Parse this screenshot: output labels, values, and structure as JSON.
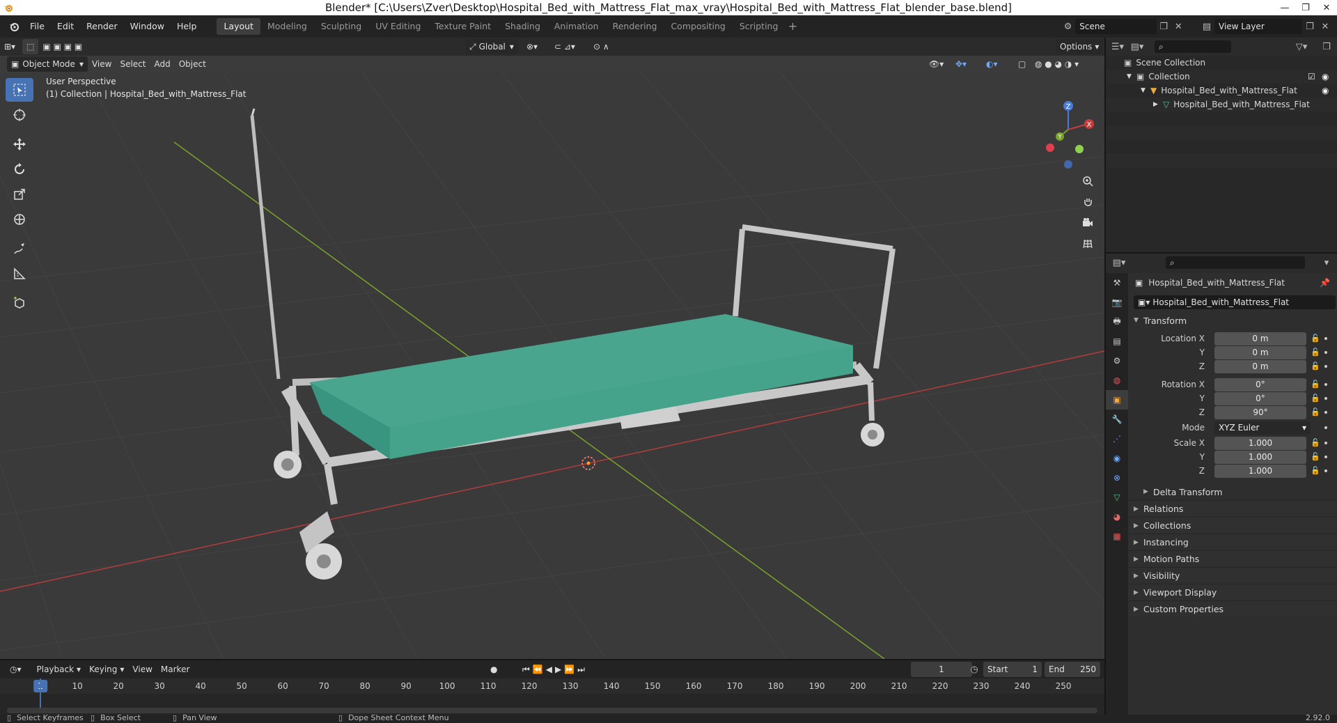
{
  "window": {
    "title": "Blender* [C:\\Users\\Zver\\Desktop\\Hospital_Bed_with_Mattress_Flat_max_vray\\Hospital_Bed_with_Mattress_Flat_blender_base.blend]"
  },
  "menu": {
    "items": [
      "File",
      "Edit",
      "Render",
      "Window",
      "Help"
    ]
  },
  "workspaces": [
    "Layout",
    "Modeling",
    "Sculpting",
    "UV Editing",
    "Texture Paint",
    "Shading",
    "Animation",
    "Rendering",
    "Compositing",
    "Scripting"
  ],
  "active_workspace": "Layout",
  "scene": {
    "name": "Scene"
  },
  "view_layer": {
    "name": "View Layer"
  },
  "viewport": {
    "mode": "Object Mode",
    "menus": [
      "View",
      "Select",
      "Add",
      "Object"
    ],
    "transform_orientation": "Global",
    "options_label": "Options",
    "perspective_label": "User Perspective",
    "collection_label": "(1) Collection | Hospital_Bed_with_Mattress_Flat",
    "gizmo_axes": {
      "x": "X",
      "y": "Y",
      "z": "Z"
    }
  },
  "outliner": {
    "rows": [
      {
        "label": "Scene Collection"
      },
      {
        "label": "Collection"
      },
      {
        "label": "Hospital_Bed_with_Mattress_Flat"
      },
      {
        "label": "Hospital_Bed_with_Mattress_Flat"
      }
    ]
  },
  "properties": {
    "object_name": "Hospital_Bed_with_Mattress_Flat",
    "name_field": "Hospital_Bed_with_Mattress_Flat",
    "transform_title": "Transform",
    "location": {
      "label": "Location X",
      "x": "0 m",
      "y": "0 m",
      "z": "0 m"
    },
    "rotation": {
      "label": "Rotation X",
      "x": "0°",
      "y": "0°",
      "z": "90°"
    },
    "mode": {
      "label": "Mode",
      "value": "XYZ Euler"
    },
    "scale": {
      "label": "Scale X",
      "x": "1.000",
      "y": "1.000",
      "z": "1.000"
    },
    "axis_y": "Y",
    "axis_z": "Z",
    "delta_transform": "Delta Transform",
    "panels": [
      "Relations",
      "Collections",
      "Instancing",
      "Motion Paths",
      "Visibility",
      "Viewport Display",
      "Custom Properties"
    ]
  },
  "timeline": {
    "menus": [
      "Playback",
      "Keying",
      "View",
      "Marker"
    ],
    "current_frame": "1",
    "start_label": "Start",
    "start": "1",
    "end_label": "End",
    "end": "250",
    "ruler_labels": [
      "1",
      "10",
      "20",
      "30",
      "40",
      "50",
      "60",
      "70",
      "80",
      "90",
      "100",
      "110",
      "120",
      "130",
      "140",
      "150",
      "160",
      "170",
      "180",
      "190",
      "200",
      "210",
      "220",
      "230",
      "240",
      "250"
    ]
  },
  "statusbar": {
    "items": [
      "Select Keyframes",
      "Box Select",
      "Pan View",
      "Dope Sheet Context Menu"
    ],
    "version": "2.92.0"
  },
  "colors": {
    "accent": "#4772b3",
    "mattress": "#4aa58f",
    "frame": "#c8c8c8",
    "x_axis": "#b53c3c",
    "y_axis": "#7aa32b"
  }
}
